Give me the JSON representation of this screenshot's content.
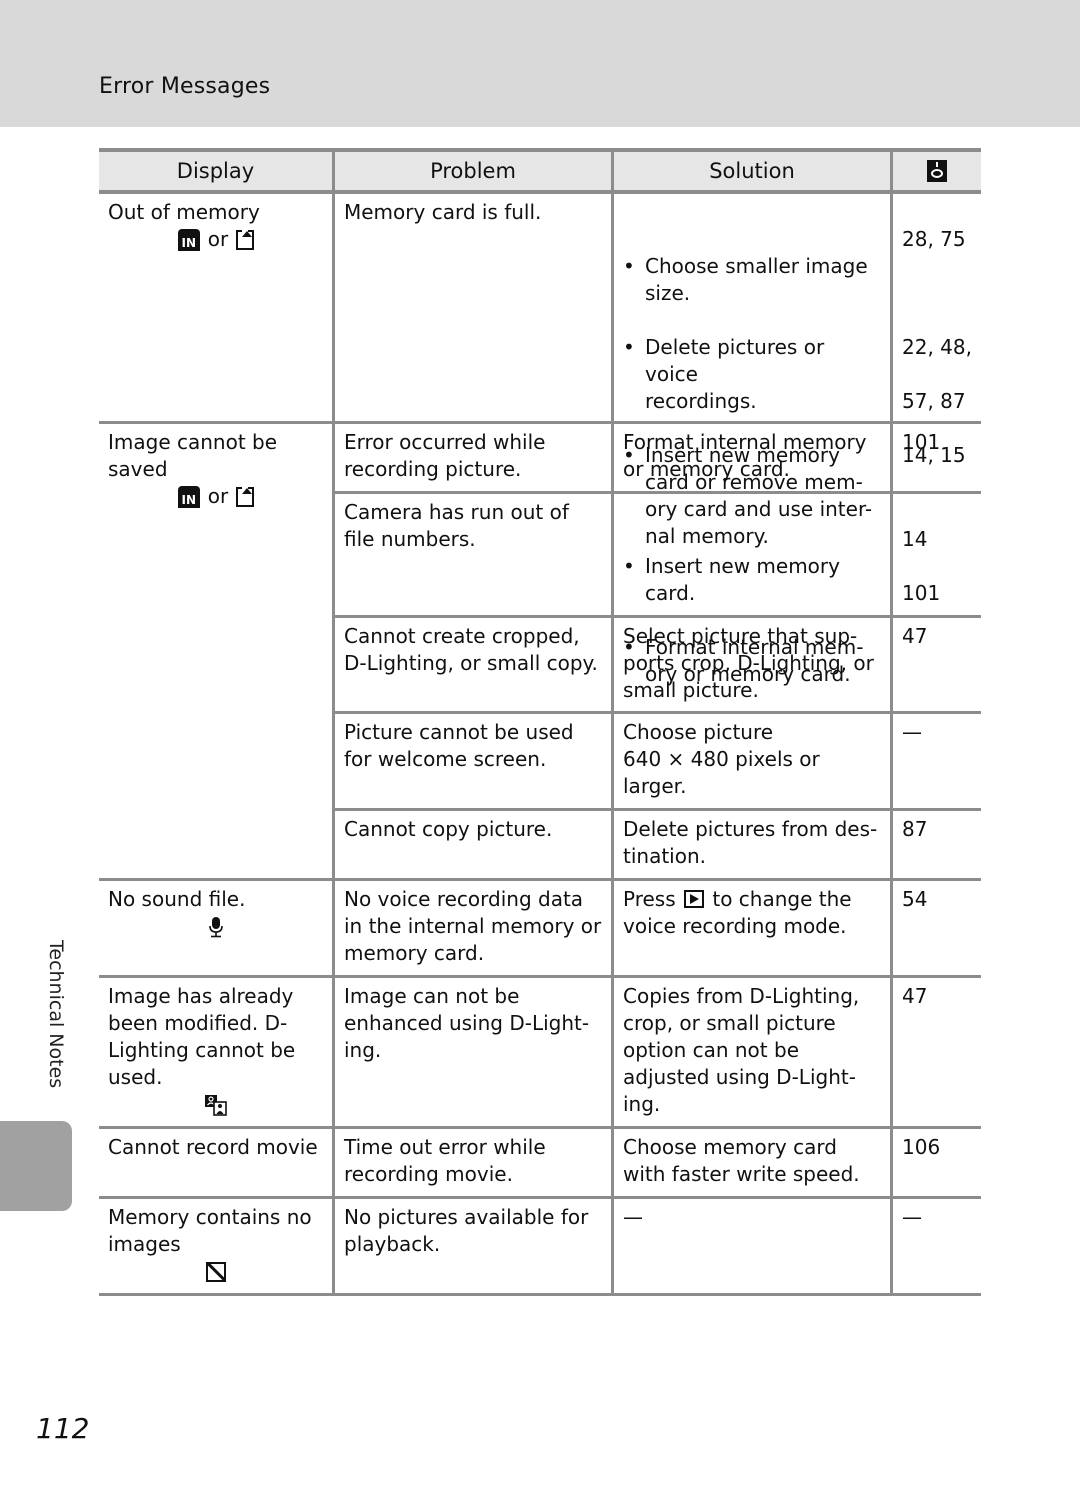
{
  "header": {
    "title": "Error Messages"
  },
  "side_label": "Technical Notes",
  "page_number": "112",
  "table": {
    "columns": [
      "Display",
      "Problem",
      "Solution"
    ],
    "reference_column_icon": "page-reference-icon",
    "connector": "or",
    "groups": [
      {
        "display": "Out of memory",
        "display_icons": [
          "internal-memory-icon",
          "memory-card-icon"
        ],
        "rows": [
          {
            "problem": "Memory card is full.",
            "solution_bullets": [
              "Choose smaller image\nsize.",
              "Delete pictures or voice\nrecordings.",
              "Insert new memory\ncard or remove mem-\nory card and use inter-\nnal memory."
            ],
            "refs": [
              "28, 75",
              "",
              "22, 48,",
              "57, 87",
              "14, 15"
            ]
          }
        ]
      },
      {
        "display": "Image cannot be\nsaved",
        "display_icons": [
          "internal-memory-icon",
          "memory-card-icon"
        ],
        "rows": [
          {
            "problem": "Error occurred while\nrecording picture.",
            "solution": "Format internal memory\nor memory card.",
            "refs": [
              "101"
            ]
          },
          {
            "problem": "Camera has run out of\nfile numbers.",
            "solution_bullets": [
              "Insert new memory\ncard.",
              "Format internal mem-\nory or memory card."
            ],
            "refs": [
              "14",
              "101"
            ]
          },
          {
            "problem": "Cannot create cropped,\nD-Lighting, or small copy.",
            "solution": "Select picture that sup-\nports crop, D-Lighting, or\nsmall picture.",
            "refs": [
              "47"
            ]
          },
          {
            "problem": "Picture cannot be used\nfor welcome screen.",
            "solution": "Choose picture\n640 × 480 pixels or\nlarger.",
            "refs": [
              "—"
            ]
          },
          {
            "problem": "Cannot copy picture.",
            "solution": "Delete pictures from des-\ntination.",
            "refs": [
              "87"
            ]
          }
        ]
      },
      {
        "display": "No sound file.",
        "display_icons": [
          "microphone-icon"
        ],
        "rows": [
          {
            "problem": "No voice recording data\nin the internal memory or\nmemory card.",
            "solution_prefix": "Press",
            "solution_icon": "playback-button-icon",
            "solution_suffix": "to change the\nvoice recording mode.",
            "refs": [
              "54"
            ]
          }
        ]
      },
      {
        "display": "Image has already\nbeen modified. D-\nLighting cannot be\nused.",
        "display_icons": [
          "d-lighting-icon"
        ],
        "rows": [
          {
            "problem": "Image can not be\nenhanced using D-Light-\ning.",
            "solution": "Copies from D-Lighting,\ncrop, or small picture\noption can not be\nadjusted using D-Light-\ning.",
            "refs": [
              "47"
            ]
          }
        ]
      },
      {
        "display": "Cannot record movie",
        "display_icons": [],
        "rows": [
          {
            "problem": "Time out error while\nrecording movie.",
            "solution": "Choose memory card\nwith faster write speed.",
            "refs": [
              "106"
            ]
          }
        ]
      },
      {
        "display": "Memory contains no\nimages",
        "display_icons": [
          "no-image-icon"
        ],
        "rows": [
          {
            "problem": "No pictures available for\nplayback.",
            "solution": "—",
            "refs": [
              "—"
            ]
          }
        ]
      }
    ]
  }
}
